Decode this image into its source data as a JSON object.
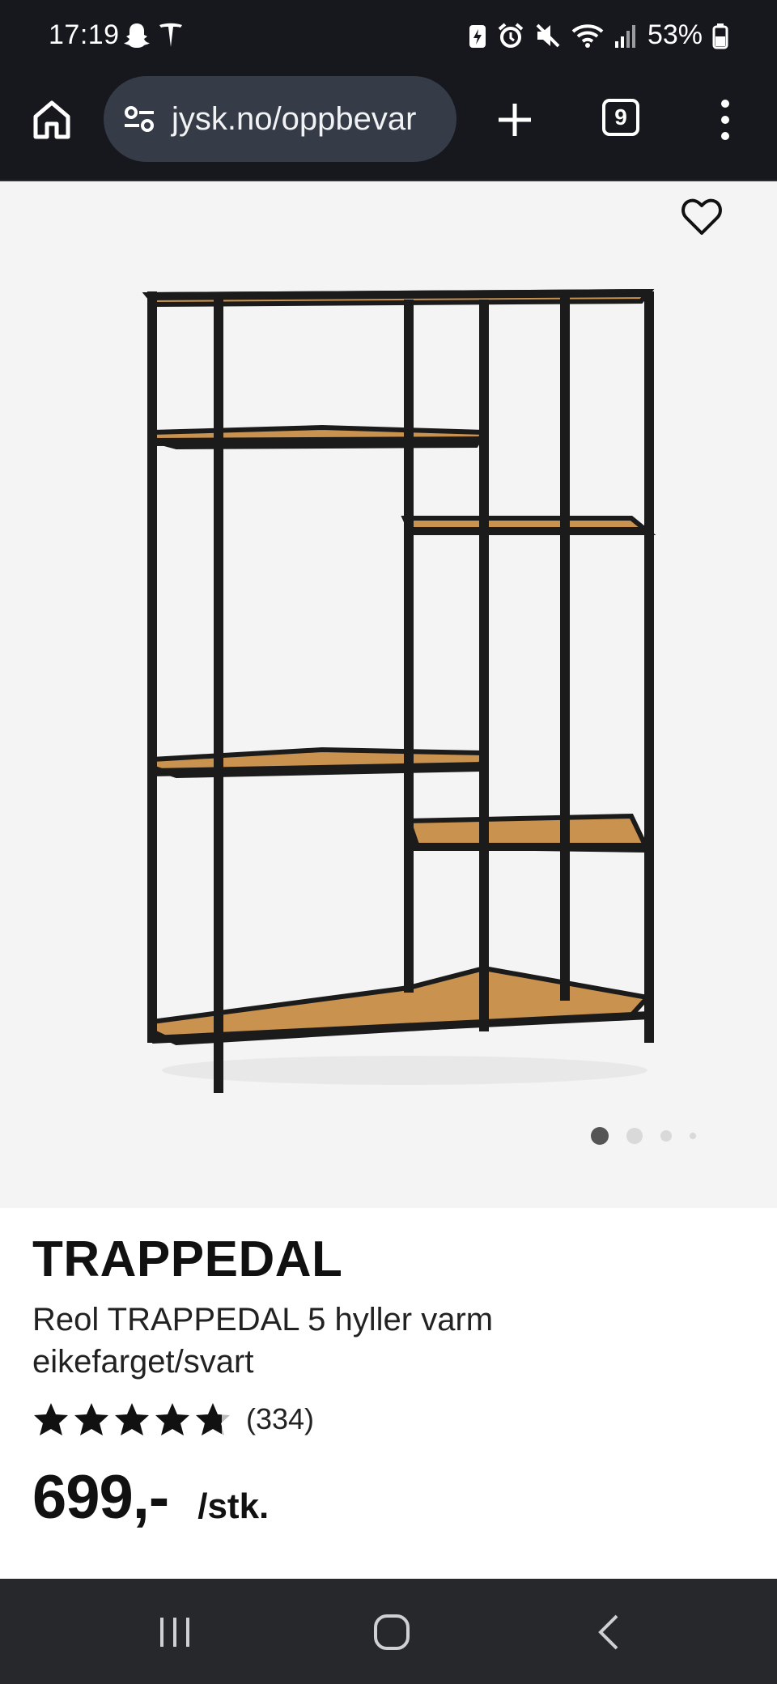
{
  "status_bar": {
    "time": "17:19",
    "battery_percent": "53%",
    "left_icons": [
      "snapchat-icon",
      "tesla-icon"
    ],
    "right_icons": [
      "battery-saver-icon",
      "alarm-icon",
      "mute-icon",
      "wifi-icon",
      "signal-icon",
      "battery-icon"
    ]
  },
  "browser": {
    "url": "jysk.no/oppbevar",
    "tab_count": "9",
    "icons": [
      "home-icon",
      "site-settings-icon",
      "plus-icon",
      "tabs-icon",
      "more-vert-icon"
    ]
  },
  "gallery": {
    "image_description": "shelf-image",
    "image_count": 4,
    "current_index": 1,
    "favorite_icon": "heart-outline-icon"
  },
  "product": {
    "brand": "TRAPPEDAL",
    "description": "Reol TRAPPEDAL 5 hyller varm eikefarget/svart",
    "rating_stars": 4.7,
    "review_count": "(334)",
    "price": "699,-",
    "unit": "/stk."
  },
  "navigation": {
    "buttons": [
      "recent-apps-icon",
      "home-circle-icon",
      "back-icon"
    ]
  },
  "colors": {
    "bar_bg": "#16181d",
    "url_bg": "#363b48",
    "gallery_bg": "#f4f4f4",
    "nav_bg": "#27282b",
    "wood": "#c9924f",
    "frame": "#1b1b1b"
  }
}
